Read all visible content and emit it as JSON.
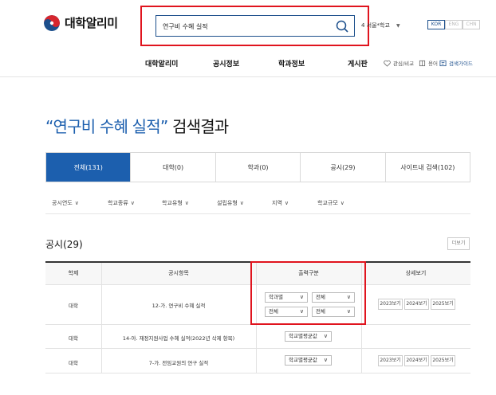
{
  "header": {
    "logo_text": "대학알리미",
    "search_value": "연구비 수혜 실적",
    "university_select": "4 서울*학교",
    "languages": [
      "KOR",
      "ENG",
      "CHN"
    ],
    "active_language": "KOR"
  },
  "nav": {
    "items": [
      "대학알리미",
      "공시정보",
      "학과정보",
      "게시판"
    ],
    "utils": [
      "관심/비교",
      "용어",
      "검색가이드"
    ]
  },
  "title": {
    "query": "“연구비 수혜 실적”",
    "suffix": " 검색결과"
  },
  "tabs": [
    {
      "label": "전체(131)",
      "active": true
    },
    {
      "label": "대학(0)",
      "active": false
    },
    {
      "label": "학과(0)",
      "active": false
    },
    {
      "label": "공시(29)",
      "active": false
    },
    {
      "label": "사이트내 검색(102)",
      "active": false
    }
  ],
  "filters": [
    "공시연도",
    "학교종류",
    "학교유형",
    "설립유형",
    "지역",
    "학교규모"
  ],
  "section": {
    "title": "공시(29)",
    "more_label": "더보기"
  },
  "table": {
    "headers": [
      "학제",
      "공시항목",
      "출력구분",
      "상세보기"
    ],
    "rows": [
      {
        "type": "대학",
        "item": "12-가. 연구비 수혜 실적",
        "selects": [
          "학과별",
          "전체",
          "전체",
          "전체"
        ],
        "views": [
          "2023보기",
          "2024보기",
          "2025보기"
        ]
      },
      {
        "type": "대학",
        "item": "14-아. 재정지원사업 수혜 실적(2022년 삭제 항목)",
        "selects": [
          "학교별평균값"
        ],
        "views": []
      },
      {
        "type": "대학",
        "item": "7-가. 전임교원의 연구 실적",
        "selects": [
          "학교별평균값"
        ],
        "views": [
          "2023보기",
          "2024보기",
          "2025보기"
        ]
      }
    ]
  },
  "colors": {
    "primary": "#1c5fae",
    "highlight": "#e0141e"
  }
}
